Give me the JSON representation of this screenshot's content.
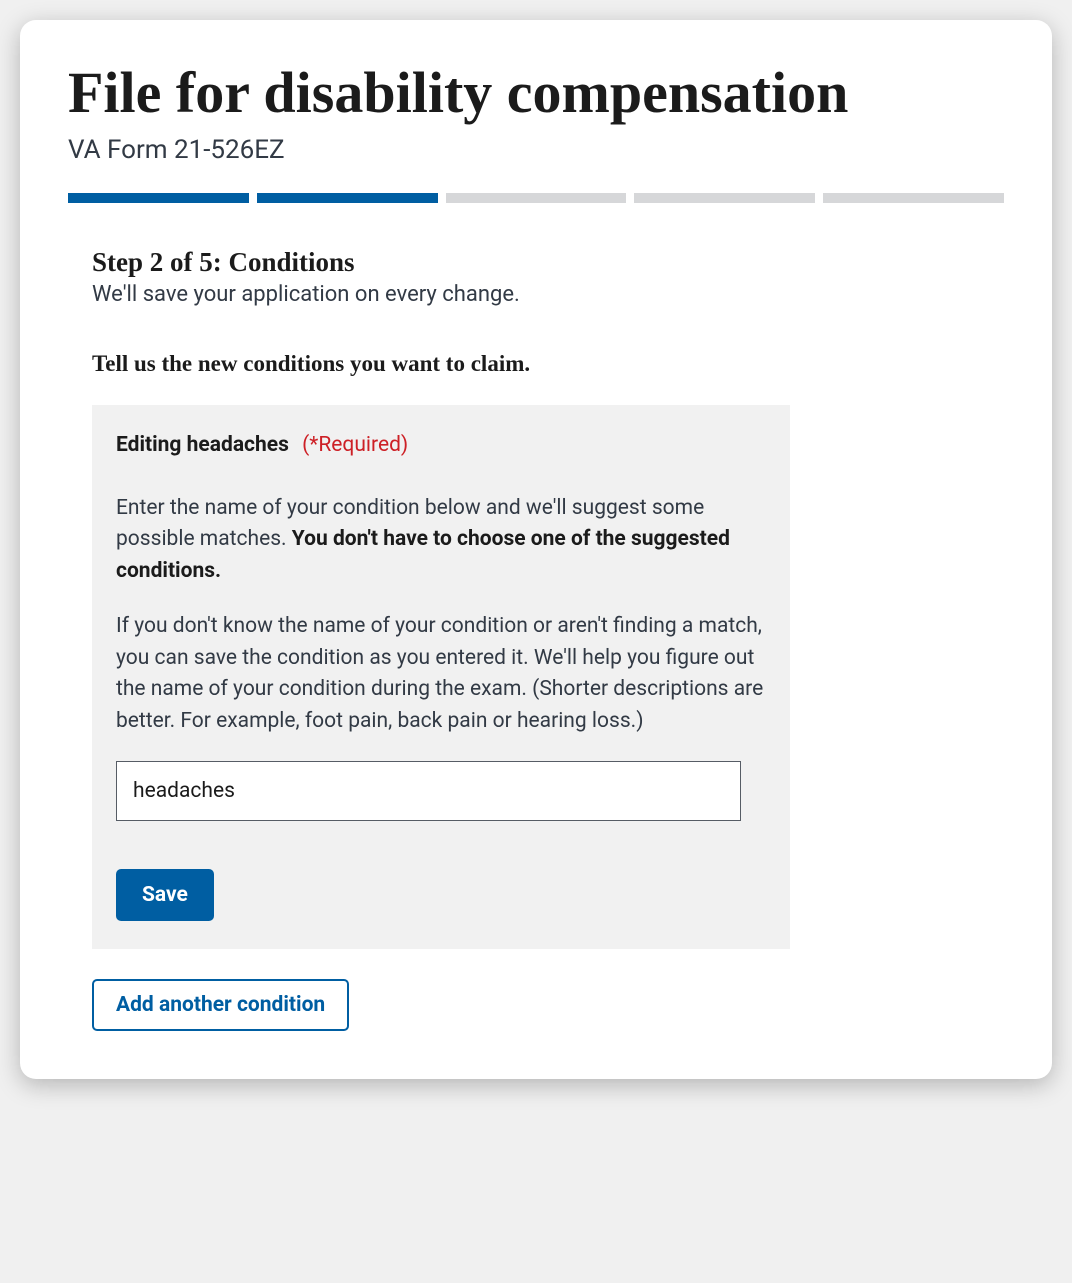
{
  "header": {
    "title": "File for disability compensation",
    "subtitle": "VA Form 21-526EZ"
  },
  "progress": {
    "total_steps": 5,
    "current_step": 2
  },
  "step": {
    "heading": "Step 2 of 5: Conditions",
    "autosave_note": "We'll save your application on every change.",
    "section_title": "Tell us the new conditions you want to claim."
  },
  "editor": {
    "editing_label": "Editing headaches",
    "required_text": "(*Required)",
    "intro_text": "Enter the name of your condition below and we'll suggest some possible matches. ",
    "intro_strong": "You don't have to choose one of the suggested conditions.",
    "help_text": "If you don't know the name of your condition or aren't finding a match, you can save the condition as you entered it. We'll help you figure out the name of your condition during the exam. (Shorter descriptions are better. For example, foot pain, back pain or hearing loss.)",
    "input_value": "headaches",
    "save_label": "Save"
  },
  "actions": {
    "add_another_label": "Add another condition"
  }
}
